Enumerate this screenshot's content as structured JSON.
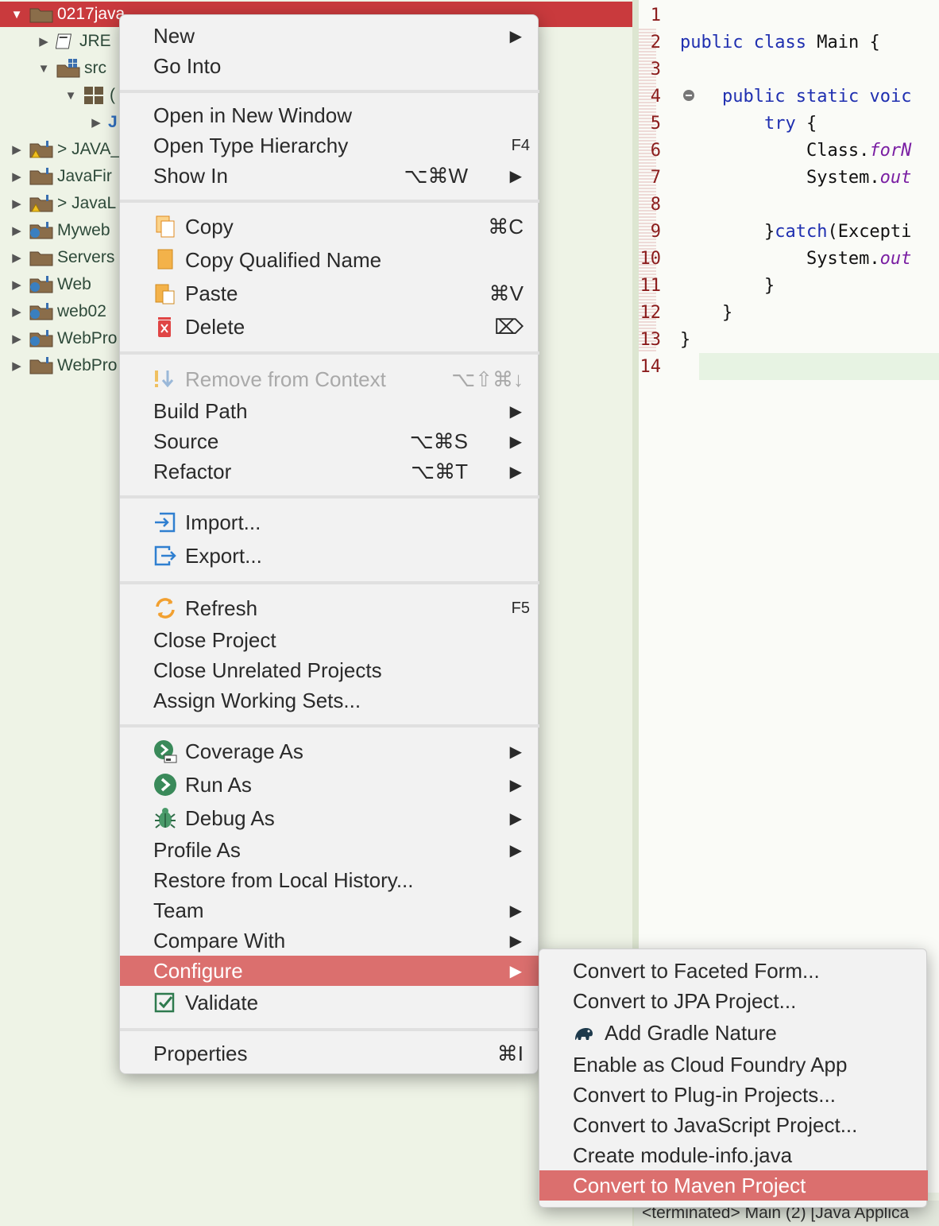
{
  "explorer": {
    "items": [
      {
        "label": "0217java",
        "expanded": true,
        "selected": true
      },
      {
        "label": "JRE"
      },
      {
        "label": "src",
        "expanded": true
      },
      {
        "label": "("
      },
      {
        "label": "J"
      },
      {
        "label": "> JAVA_"
      },
      {
        "label": "JavaFir"
      },
      {
        "label": "> JavaL"
      },
      {
        "label": "Myweb"
      },
      {
        "label": "Servers"
      },
      {
        "label": "Web"
      },
      {
        "label": "web02"
      },
      {
        "label": "WebPro"
      },
      {
        "label": "WebPro"
      }
    ]
  },
  "editor": {
    "lines": [
      {
        "n": "1",
        "text": ""
      },
      {
        "n": "2",
        "text": "public class Main {"
      },
      {
        "n": "3",
        "text": ""
      },
      {
        "n": "4",
        "text": "public static voic"
      },
      {
        "n": "5",
        "text": "try {"
      },
      {
        "n": "6",
        "text": "Class.forN"
      },
      {
        "n": "7",
        "text": "System.out"
      },
      {
        "n": "8",
        "text": ""
      },
      {
        "n": "9",
        "text": "}catch(Excepti"
      },
      {
        "n": "10",
        "text": "System.out"
      },
      {
        "n": "11",
        "text": "}"
      },
      {
        "n": "12",
        "text": "}"
      },
      {
        "n": "13",
        "text": "}"
      },
      {
        "n": "14",
        "text": ""
      }
    ],
    "tokens": {
      "public": "public",
      "class": "class",
      "main": "Main {",
      "static": "static",
      "voic": "voic",
      "try": "try",
      "brace_open": " {",
      "class_dot": "Class.",
      "forN": "forN",
      "system_dot": "System.",
      "out": "out",
      "catch_close": "}",
      "catch": "catch",
      "excepti": "(Excepti",
      "close": "}"
    }
  },
  "console": {
    "label": "<terminated> Main (2) [Java Applica"
  },
  "context_menu": {
    "new": {
      "label": "New"
    },
    "go_into": {
      "label": "Go Into"
    },
    "open_new_window": {
      "label": "Open in New Window"
    },
    "open_type_hierarchy": {
      "label": "Open Type Hierarchy",
      "shortcut": "F4"
    },
    "show_in": {
      "label": "Show In",
      "shortcut": "⌥⌘W"
    },
    "copy": {
      "label": "Copy",
      "shortcut": "⌘C"
    },
    "copy_qualified": {
      "label": "Copy Qualified Name"
    },
    "paste": {
      "label": "Paste",
      "shortcut": "⌘V"
    },
    "delete": {
      "label": "Delete",
      "shortcut": "⌦"
    },
    "remove_context": {
      "label": "Remove from Context",
      "shortcut": "⌥⇧⌘↓"
    },
    "build_path": {
      "label": "Build Path"
    },
    "source": {
      "label": "Source",
      "shortcut": "⌥⌘S"
    },
    "refactor": {
      "label": "Refactor",
      "shortcut": "⌥⌘T"
    },
    "import": {
      "label": "Import..."
    },
    "export": {
      "label": "Export..."
    },
    "refresh": {
      "label": "Refresh",
      "shortcut": "F5"
    },
    "close_project": {
      "label": "Close Project"
    },
    "close_unrelated": {
      "label": "Close Unrelated Projects"
    },
    "assign_working_sets": {
      "label": "Assign Working Sets..."
    },
    "coverage_as": {
      "label": "Coverage As"
    },
    "run_as": {
      "label": "Run As"
    },
    "debug_as": {
      "label": "Debug As"
    },
    "profile_as": {
      "label": "Profile As"
    },
    "restore_history": {
      "label": "Restore from Local History..."
    },
    "team": {
      "label": "Team"
    },
    "compare_with": {
      "label": "Compare With"
    },
    "configure": {
      "label": "Configure"
    },
    "validate": {
      "label": "Validate"
    },
    "properties": {
      "label": "Properties",
      "shortcut": "⌘I"
    },
    "arrow": "▶"
  },
  "configure_submenu": {
    "items": [
      {
        "label": "Convert to Faceted Form..."
      },
      {
        "label": "Convert to JPA Project..."
      },
      {
        "label": "Add Gradle Nature"
      },
      {
        "label": "Enable as Cloud Foundry App"
      },
      {
        "label": "Convert to Plug-in Projects..."
      },
      {
        "label": "Convert to JavaScript Project..."
      },
      {
        "label": "Create module-info.java"
      },
      {
        "label": "Convert to Maven Project",
        "highlighted": true
      }
    ]
  },
  "colors": {
    "selection": "#c93a3d",
    "menu_highlight": "#db6f6e",
    "keyword": "#1f2fb0",
    "line_number": "#8b1c1c"
  }
}
